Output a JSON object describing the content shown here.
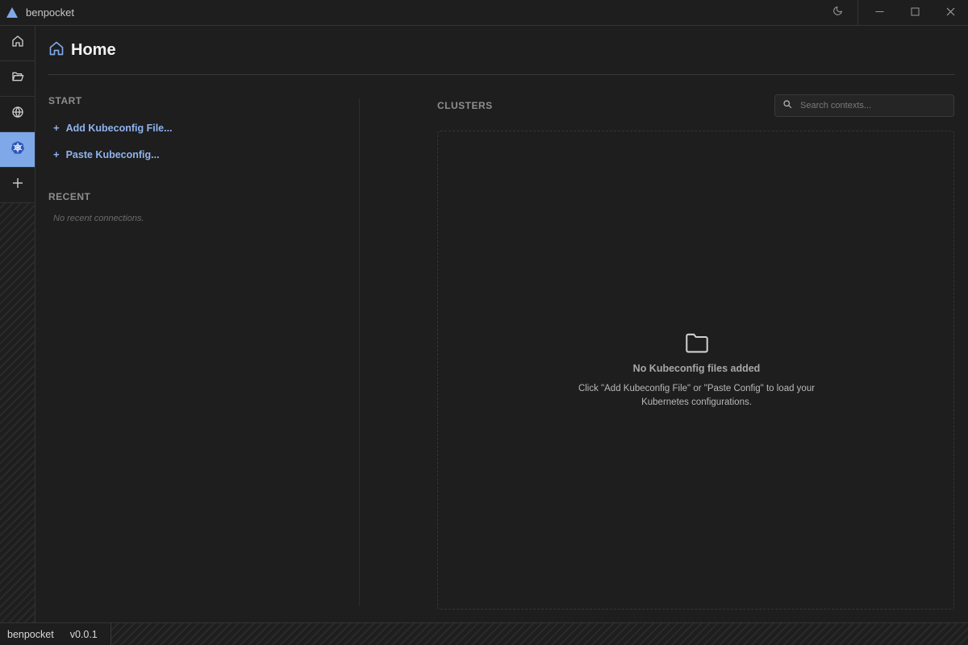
{
  "app": {
    "title": "benpocket",
    "accent": "#7fa8e8"
  },
  "titlebar": {
    "theme_icon": "moon-icon",
    "minimize_icon": "minimize-icon",
    "maximize_icon": "maximize-icon",
    "close_icon": "close-icon"
  },
  "sidebar": {
    "items": [
      {
        "icon": "home-icon",
        "active": false
      },
      {
        "icon": "folder-open-icon",
        "active": false
      },
      {
        "icon": "globe-icon",
        "active": false
      },
      {
        "icon": "kubernetes-icon",
        "active": true
      },
      {
        "icon": "plus-icon",
        "active": false
      }
    ]
  },
  "page": {
    "title": "Home",
    "icon": "home-icon"
  },
  "start": {
    "label": "START",
    "actions": [
      {
        "label": "Add Kubeconfig File..."
      },
      {
        "label": "Paste Kubeconfig..."
      }
    ]
  },
  "recent": {
    "label": "RECENT",
    "empty_text": "No recent connections."
  },
  "clusters": {
    "label": "CLUSTERS",
    "search_placeholder": "Search contexts...",
    "empty_title": "No Kubeconfig files added",
    "empty_desc": "Click \"Add Kubeconfig File\" or \"Paste Config\" to load your Kubernetes configurations."
  },
  "status": {
    "app_name": "benpocket",
    "version": "v0.0.1"
  }
}
